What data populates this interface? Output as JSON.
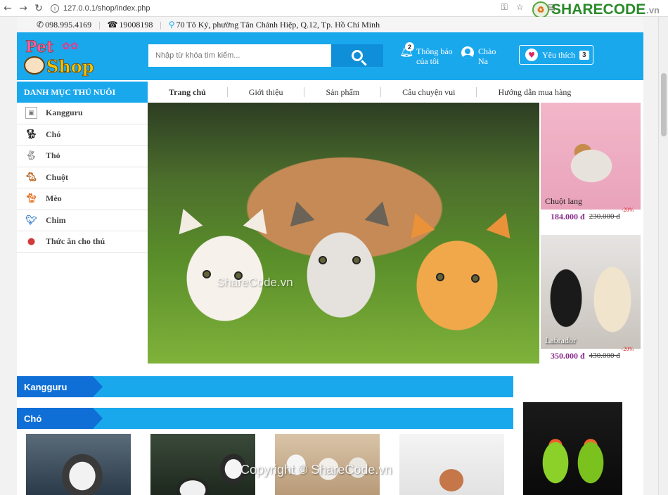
{
  "browser": {
    "url": "127.0.0.1/shop/index.php",
    "brand_name": "SHARECODE",
    "brand_tld": ".vn"
  },
  "contact": {
    "phone": "098.995.4169",
    "hotline": "19008198",
    "address": "70 Tô Ký, phường Tân Chánh Hiệp, Q.12, Tp. Hồ Chí Minh"
  },
  "header": {
    "logo_pet": "Pet",
    "logo_shop": "Shop",
    "search_placeholder": "Nhập từ khóa tìm kiếm...",
    "notify_count": "2",
    "notify_line1": "Thông báo",
    "notify_line2": "của tôi",
    "user_line1": "Chào",
    "user_line2": "Na",
    "wishlist_label": "Yêu thích",
    "wishlist_count": "3"
  },
  "sidebar": {
    "title": "DANH MỤC THÚ NUÔI",
    "items": [
      {
        "label": "Kangguru",
        "icon": "kangaroo-icon"
      },
      {
        "label": "Chó",
        "icon": "dog-icon"
      },
      {
        "label": "Thỏ",
        "icon": "rabbit-icon"
      },
      {
        "label": "Chuột",
        "icon": "mouse-icon"
      },
      {
        "label": "Mèo",
        "icon": "cat-icon"
      },
      {
        "label": "Chim",
        "icon": "bird-icon"
      },
      {
        "label": "Thức ăn cho thú",
        "icon": "pet-food-icon"
      }
    ]
  },
  "menu": {
    "items": [
      "Trang chủ",
      "Giới thiệu",
      "Sản phẩm",
      "Câu chuyện vui",
      "Hướng dẫn mua hàng"
    ]
  },
  "banner": {
    "watermark": "ShareCode.vn"
  },
  "side_products": [
    {
      "name": "Chuột lang",
      "price": "184.000 đ",
      "old_price": "230.000 đ",
      "discount": "-20%"
    },
    {
      "name": "Labrador",
      "price": "350.000 đ",
      "old_price": "430.000 đ",
      "discount": "-20%"
    }
  ],
  "sections": [
    {
      "title": "Kangguru"
    },
    {
      "title": "Chó"
    }
  ],
  "footer": {
    "copyright": "Copyright © ShareCode.vn"
  },
  "colors": {
    "primary": "#1aa8ed",
    "section_tab": "#0f6fd6",
    "price": "#8a2b8c"
  }
}
